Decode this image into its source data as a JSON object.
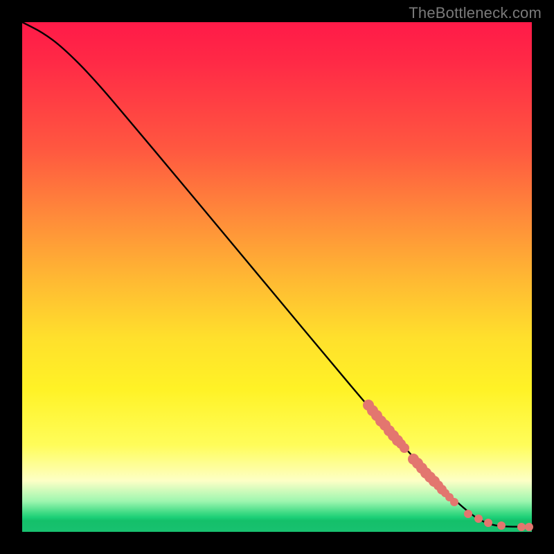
{
  "attribution": "TheBottleneck.com",
  "colors": {
    "dot": "#e3766f",
    "curve": "#000000",
    "background_top": "#ff1a48",
    "background_bottom": "#18c170"
  },
  "chart_data": {
    "type": "line",
    "title": "",
    "xlabel": "",
    "ylabel": "",
    "xlim": [
      0,
      100
    ],
    "ylim": [
      0,
      100
    ],
    "grid": false,
    "legend": false,
    "axis_visible": false,
    "curve": [
      {
        "x": 0,
        "y": 100
      },
      {
        "x": 4,
        "y": 98
      },
      {
        "x": 8,
        "y": 95
      },
      {
        "x": 14,
        "y": 89
      },
      {
        "x": 22,
        "y": 79.5
      },
      {
        "x": 30,
        "y": 70
      },
      {
        "x": 40,
        "y": 58
      },
      {
        "x": 50,
        "y": 46
      },
      {
        "x": 60,
        "y": 34
      },
      {
        "x": 68,
        "y": 24.5
      },
      {
        "x": 72,
        "y": 20
      },
      {
        "x": 76,
        "y": 15.5
      },
      {
        "x": 80,
        "y": 11
      },
      {
        "x": 84,
        "y": 7
      },
      {
        "x": 88,
        "y": 3.5
      },
      {
        "x": 90,
        "y": 2.2
      },
      {
        "x": 92,
        "y": 1.4
      },
      {
        "x": 94,
        "y": 1.1
      },
      {
        "x": 96,
        "y": 1.0
      },
      {
        "x": 100,
        "y": 1.0
      }
    ],
    "marker_points": [
      {
        "x": 68.0,
        "y": 24.8,
        "r": 8
      },
      {
        "x": 68.8,
        "y": 23.8,
        "r": 8
      },
      {
        "x": 69.6,
        "y": 22.8,
        "r": 8
      },
      {
        "x": 70.4,
        "y": 21.8,
        "r": 8
      },
      {
        "x": 71.2,
        "y": 20.9,
        "r": 8
      },
      {
        "x": 72.0,
        "y": 19.9,
        "r": 8
      },
      {
        "x": 72.8,
        "y": 18.9,
        "r": 8
      },
      {
        "x": 73.6,
        "y": 18.0,
        "r": 8
      },
      {
        "x": 74.3,
        "y": 17.2,
        "r": 7
      },
      {
        "x": 75.0,
        "y": 16.4,
        "r": 7
      },
      {
        "x": 76.8,
        "y": 14.3,
        "r": 8
      },
      {
        "x": 77.6,
        "y": 13.4,
        "r": 8
      },
      {
        "x": 78.4,
        "y": 12.5,
        "r": 8
      },
      {
        "x": 79.2,
        "y": 11.6,
        "r": 8
      },
      {
        "x": 80.0,
        "y": 10.8,
        "r": 8
      },
      {
        "x": 80.8,
        "y": 9.9,
        "r": 8
      },
      {
        "x": 81.6,
        "y": 9.1,
        "r": 7
      },
      {
        "x": 82.3,
        "y": 8.3,
        "r": 7
      },
      {
        "x": 83.0,
        "y": 7.6,
        "r": 6
      },
      {
        "x": 83.8,
        "y": 6.8,
        "r": 6
      },
      {
        "x": 84.8,
        "y": 5.8,
        "r": 6
      },
      {
        "x": 87.5,
        "y": 3.6,
        "r": 6
      },
      {
        "x": 89.5,
        "y": 2.6,
        "r": 6
      },
      {
        "x": 91.5,
        "y": 1.7,
        "r": 6
      },
      {
        "x": 94.0,
        "y": 1.2,
        "r": 6
      },
      {
        "x": 98.0,
        "y": 1.0,
        "r": 6
      },
      {
        "x": 99.5,
        "y": 1.0,
        "r": 6
      }
    ]
  }
}
